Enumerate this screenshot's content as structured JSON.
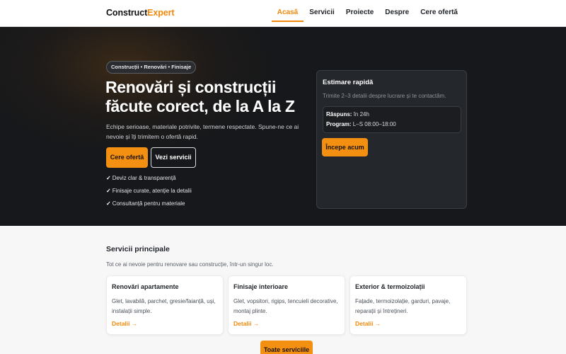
{
  "brand": {
    "name_part1": "Construct",
    "name_part2": "Expert",
    "accent_color": "#f0890c"
  },
  "nav": {
    "items": [
      {
        "label": "Acasă",
        "active": true
      },
      {
        "label": "Servicii",
        "active": false
      },
      {
        "label": "Proiecte",
        "active": false
      },
      {
        "label": "Despre",
        "active": false
      },
      {
        "label": "Cere ofertă",
        "active": false
      }
    ]
  },
  "hero": {
    "badge": "Construcții • Renovări • Finisaje",
    "title": "Renovări și construcții făcute corect, de la A la Z",
    "subtitle": "Echipe serioase, materiale potrivite, termene respectate. Spune-ne ce ai nevoie și îți trimitem o ofertă rapid.",
    "primary_button": "Cere ofertă",
    "secondary_button": "Vezi servicii",
    "checks": [
      "Deviz clar & transparență",
      "Finisaje curate, atenție la detalii",
      "Consultanță pentru materiale"
    ],
    "check_mark": "✓"
  },
  "quote_card": {
    "title": "Estimare rapidă",
    "subtitle": "Trimite 2–3 detalii despre lucrare și te contactăm.",
    "response_label": "Răspuns:",
    "response_value": "în 24h",
    "schedule_label": "Program:",
    "schedule_value": "L–S 08:00–18:00",
    "button": "Începe acum"
  },
  "services": {
    "title": "Servicii principale",
    "subtitle": "Tot ce ai nevoie pentru renovare sau construcție, într-un singur loc.",
    "cards": [
      {
        "title": "Renovări apartamente",
        "description": "Glet, lavabilă, parchet, gresie/faianță, uși, instalații simple.",
        "link": "Detalii →"
      },
      {
        "title": "Finisaje interioare",
        "description": "Glet, vopsitori, rigips, tencuieli decorative, montaj plinte.",
        "link": "Detalii →"
      },
      {
        "title": "Exterior & termoizolații",
        "description": "Fațade, termoizolație, garduri, pavaje, reparații și întrețineri.",
        "link": "Detalii →"
      }
    ],
    "all_button": "Toate serviciile"
  }
}
